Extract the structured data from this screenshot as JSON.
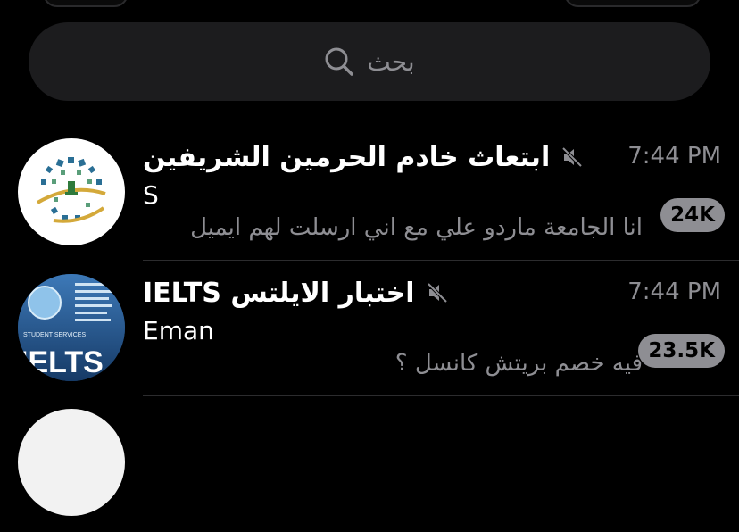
{
  "search": {
    "placeholder": "بحث"
  },
  "chats": [
    {
      "title": "ابتعاث خادم الحرمين الشريفين",
      "muted": true,
      "time": "7:44 PM",
      "sender": "S",
      "preview": "انا الجامعة ماردو علي مع اني ارسلت لهم ايميل",
      "badge": "24K",
      "avatar": "logo-avatar"
    },
    {
      "title": "اختبار الايلتس IELTS",
      "muted": true,
      "time": "7:44 PM",
      "sender": "Eman",
      "preview": "فيه خصم بريتش كانسل ؟",
      "badge": "23.5K",
      "avatar": "ielts-avatar",
      "avatar_text": "IELTS",
      "avatar_caption": "STUDENT SERVICES"
    }
  ],
  "colors": {
    "background": "#000000",
    "search_bg": "#1c1c1e",
    "secondary_text": "#8e8e93",
    "badge_bg": "#8e8e93",
    "divider": "#2c2c2e"
  }
}
